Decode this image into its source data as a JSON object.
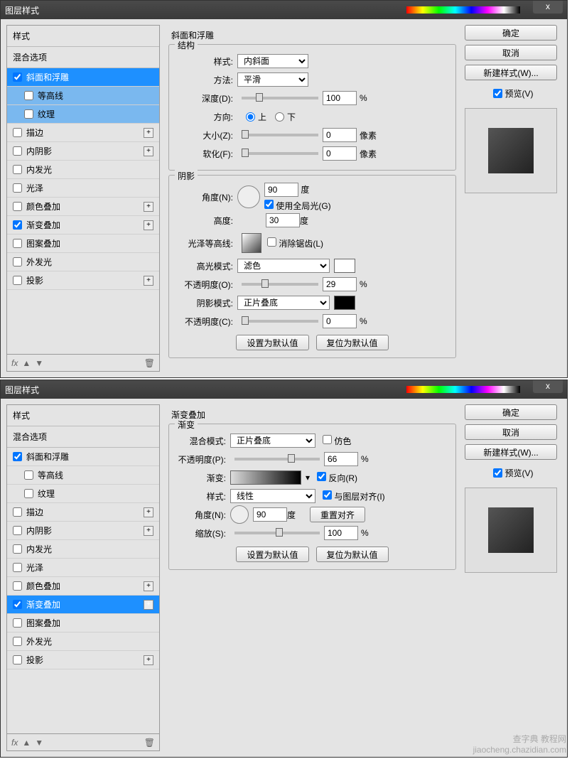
{
  "d1": {
    "title": "图层样式",
    "styles_header": "样式",
    "blend_header": "混合选项",
    "items": [
      {
        "label": "斜面和浮雕",
        "checked": true
      },
      {
        "label": "等高线",
        "checked": false,
        "sub": true
      },
      {
        "label": "纹理",
        "checked": false,
        "sub": true
      },
      {
        "label": "描边",
        "checked": false
      },
      {
        "label": "内阴影",
        "checked": false
      },
      {
        "label": "内发光",
        "checked": false
      },
      {
        "label": "光泽",
        "checked": false
      },
      {
        "label": "颜色叠加",
        "checked": false
      },
      {
        "label": "渐变叠加",
        "checked": true
      },
      {
        "label": "图案叠加",
        "checked": false
      },
      {
        "label": "外发光",
        "checked": false
      },
      {
        "label": "投影",
        "checked": false
      }
    ],
    "fx": "fx",
    "panel_title": "斜面和浮雕",
    "struct": "结构",
    "style_lbl": "样式:",
    "style_val": "内斜面",
    "method_lbl": "方法:",
    "method_val": "平滑",
    "depth_lbl": "深度(D):",
    "depth_val": "100",
    "pct": "%",
    "dir_lbl": "方向:",
    "dir_up": "上",
    "dir_down": "下",
    "size_lbl": "大小(Z):",
    "size_val": "0",
    "px": "像素",
    "soft_lbl": "软化(F):",
    "soft_val": "0",
    "shade": "阴影",
    "angle_lbl": "角度(N):",
    "angle_val": "90",
    "deg": "度",
    "global": "使用全局光(G)",
    "alt_lbl": "高度:",
    "alt_val": "30",
    "gloss_lbl": "光泽等高线:",
    "aa": "消除锯齿(L)",
    "hmode_lbl": "高光模式:",
    "hmode_val": "滤色",
    "hop_lbl": "不透明度(O):",
    "hop_val": "29",
    "smode_lbl": "阴影模式:",
    "smode_val": "正片叠底",
    "sop_lbl": "不透明度(C):",
    "sop_val": "0",
    "make_def": "设置为默认值",
    "reset_def": "复位为默认值",
    "ok": "确定",
    "cancel": "取消",
    "newstyle": "新建样式(W)...",
    "preview": "预览(V)"
  },
  "d2": {
    "title": "图层样式",
    "styles_header": "样式",
    "blend_header": "混合选项",
    "items": [
      {
        "label": "斜面和浮雕",
        "checked": true
      },
      {
        "label": "等高线",
        "checked": false,
        "sub": true
      },
      {
        "label": "纹理",
        "checked": false,
        "sub": true
      },
      {
        "label": "描边",
        "checked": false
      },
      {
        "label": "内阴影",
        "checked": false
      },
      {
        "label": "内发光",
        "checked": false
      },
      {
        "label": "光泽",
        "checked": false
      },
      {
        "label": "颜色叠加",
        "checked": false
      },
      {
        "label": "渐变叠加",
        "checked": true
      },
      {
        "label": "图案叠加",
        "checked": false
      },
      {
        "label": "外发光",
        "checked": false
      },
      {
        "label": "投影",
        "checked": false
      }
    ],
    "fx": "fx",
    "panel_title": "渐变叠加",
    "group": "渐变",
    "bmode_lbl": "混合模式:",
    "bmode_val": "正片叠底",
    "dither": "仿色",
    "op_lbl": "不透明度(P):",
    "op_val": "66",
    "pct": "%",
    "grad_lbl": "渐变:",
    "reverse": "反向(R)",
    "style_lbl": "样式:",
    "style_val": "线性",
    "align": "与图层对齐(I)",
    "angle_lbl": "角度(N):",
    "angle_val": "90",
    "deg": "度",
    "reset_align": "重置对齐",
    "scale_lbl": "缩放(S):",
    "scale_val": "100",
    "make_def": "设置为默认值",
    "reset_def": "复位为默认值",
    "ok": "确定",
    "cancel": "取消",
    "newstyle": "新建样式(W)...",
    "preview": "预览(V)"
  },
  "watermark_line1": "查字典 教程网",
  "watermark_line2": "jiaocheng.chazidian.com"
}
